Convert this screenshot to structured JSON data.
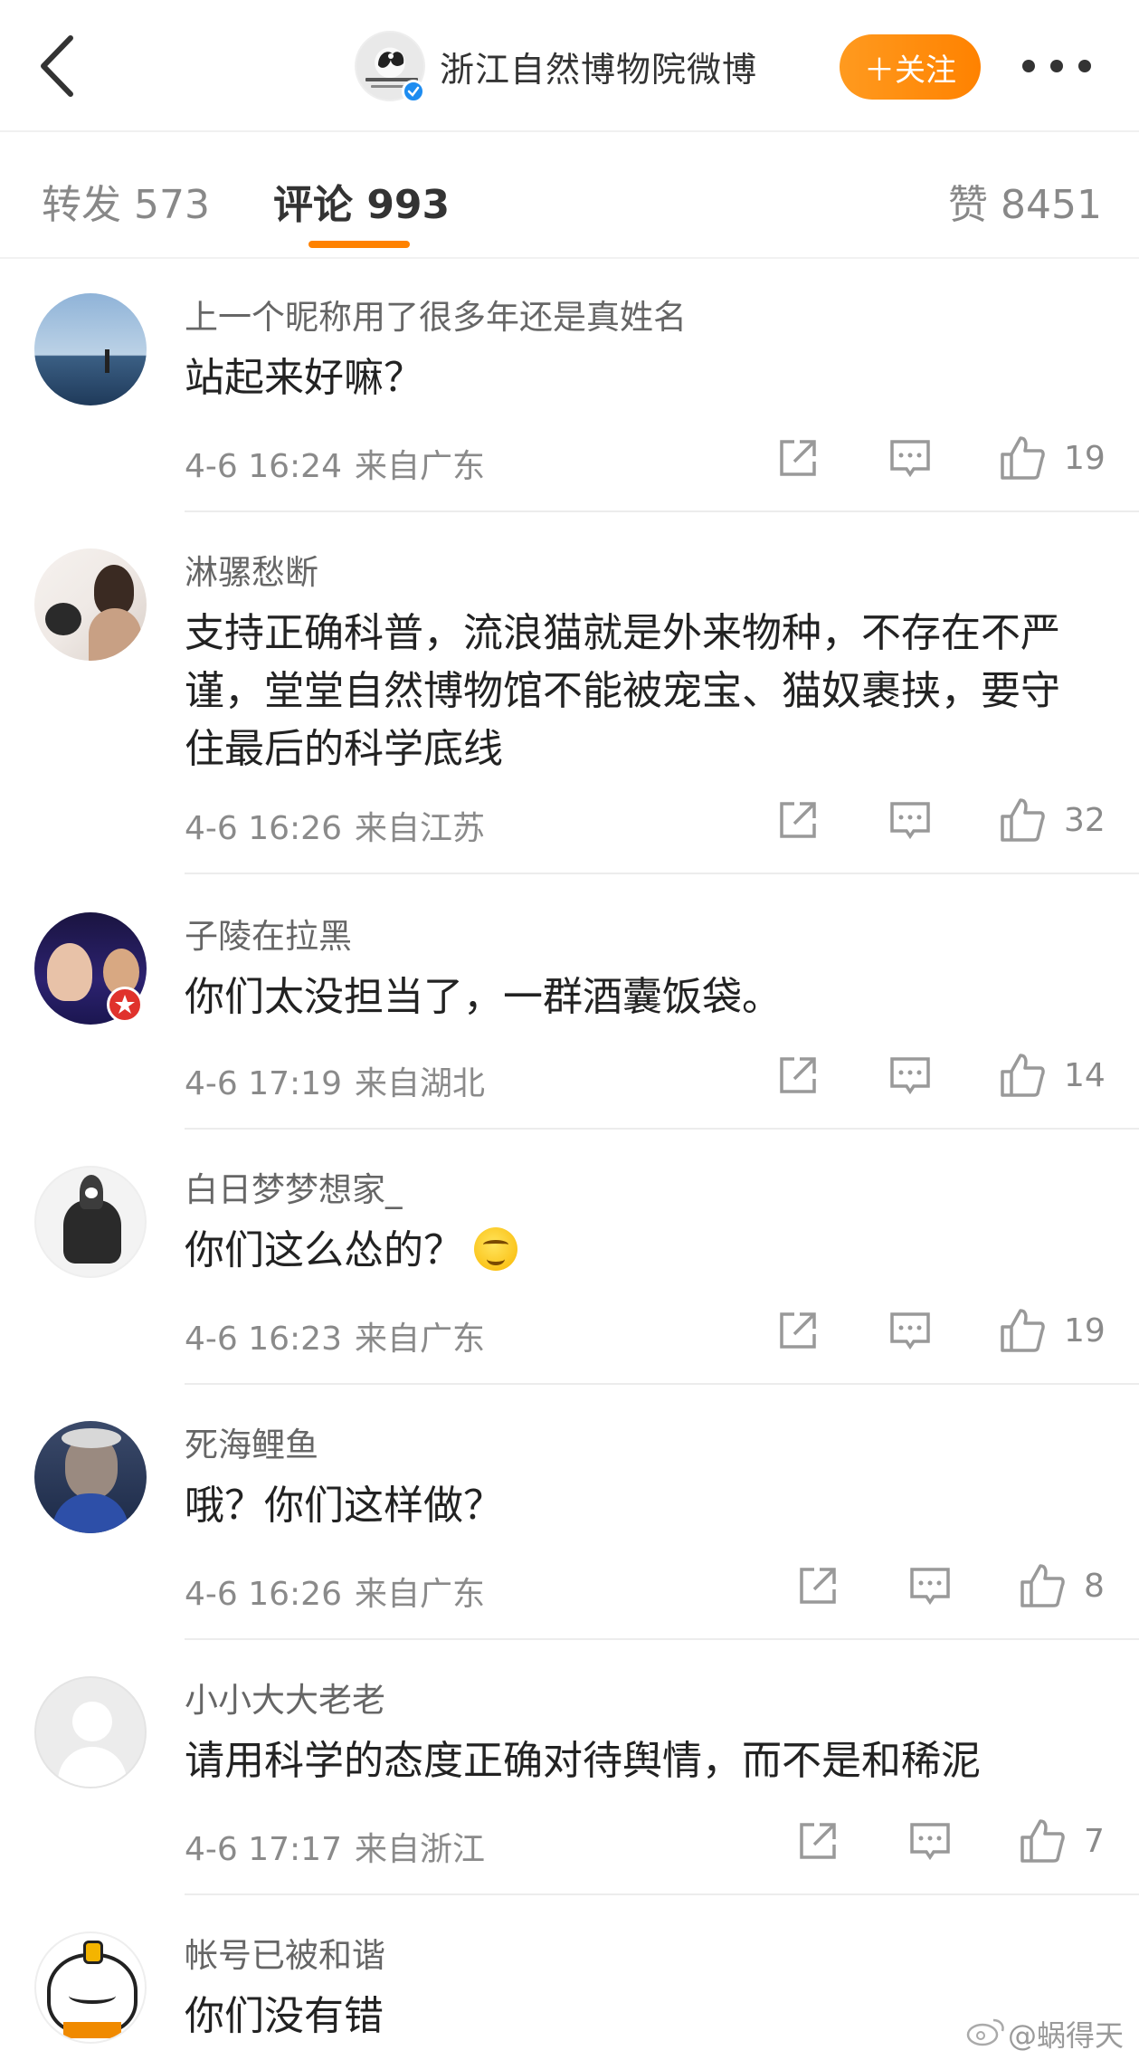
{
  "header": {
    "account_name": "浙江自然博物院微博",
    "follow_label": "＋关注"
  },
  "tabs": [
    {
      "label": "转发 573"
    },
    {
      "label": "评论 993"
    },
    {
      "label": "赞 8451"
    }
  ],
  "comments": [
    {
      "user": "上一个昵称用了很多年还是真姓名",
      "text": "站起来好嘛？",
      "time": "4-6 16:24",
      "region": "来自广东",
      "likes": "19"
    },
    {
      "user": "淋骡愁断",
      "text": "支持正确科普，流浪猫就是外来物种，不存在不严谨，堂堂自然博物馆不能被宠宝、猫奴裹挟，要守住最后的科学底线",
      "time": "4-6 16:26",
      "region": "来自江苏",
      "likes": "32"
    },
    {
      "user": "子陵在拉黑",
      "text": "你们太没担当了，一群酒囊饭袋。",
      "time": "4-6 17:19",
      "region": "来自湖北",
      "likes": "14"
    },
    {
      "user": "白日梦梦想家_",
      "text": "你们这么怂的？",
      "time": "4-6 16:23",
      "region": "来自广东",
      "likes": "19"
    },
    {
      "user": "死海鲤鱼",
      "text": "哦？你们这样做？",
      "time": "4-6 16:26",
      "region": "来自广东",
      "likes": "8"
    },
    {
      "user": "小小大大老老",
      "text": "请用科学的态度正确对待舆情，而不是和稀泥",
      "time": "4-6 17:17",
      "region": "来自浙江",
      "likes": "7"
    },
    {
      "user": "帐号已被和谐",
      "text": "你们没有错"
    }
  ],
  "watermark": "@蜗得天",
  "icons": {
    "back": "chevron-left-icon",
    "more": "more-dots-icon",
    "share": "share-icon",
    "reply": "comment-icon",
    "like": "thumbs-up-icon"
  },
  "colors": {
    "accent": "#ff8200",
    "verified": "#1d8cf0"
  }
}
